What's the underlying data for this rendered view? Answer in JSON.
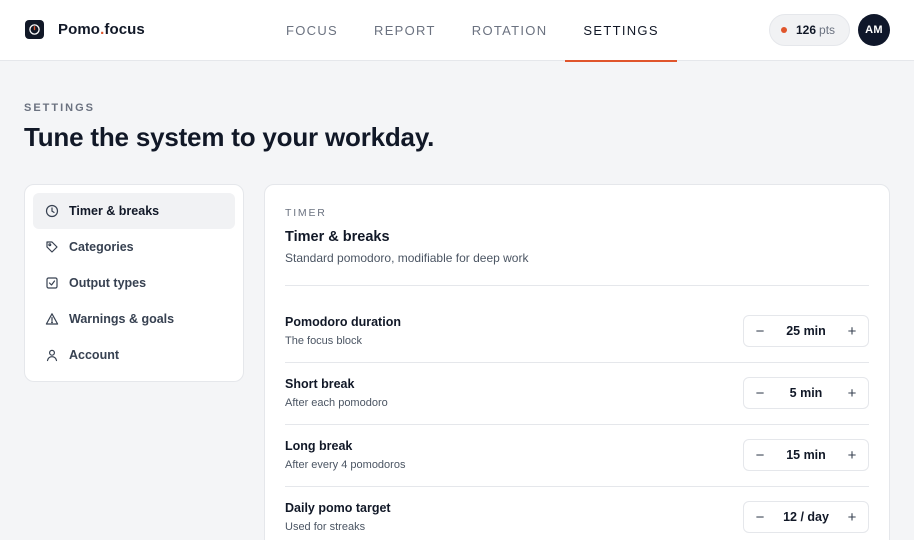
{
  "brand": {
    "name": "Pomo",
    "dot": ".",
    "suffix": "focus"
  },
  "nav": {
    "tabs": [
      {
        "label": "FOCUS"
      },
      {
        "label": "REPORT"
      },
      {
        "label": "ROTATION"
      },
      {
        "label": "SETTINGS",
        "active": true
      }
    ]
  },
  "points": {
    "value": "126",
    "unit": "pts"
  },
  "user": {
    "initials": "AM"
  },
  "page": {
    "eyebrow": "SETTINGS",
    "title": "Tune the system to your workday."
  },
  "sidebar": {
    "items": [
      {
        "label": "Timer & breaks",
        "icon": "clock-icon",
        "active": true
      },
      {
        "label": "Categories",
        "icon": "tag-icon"
      },
      {
        "label": "Output types",
        "icon": "checkbox-icon"
      },
      {
        "label": "Warnings & goals",
        "icon": "warning-icon"
      },
      {
        "label": "Account",
        "icon": "user-icon"
      }
    ]
  },
  "section": {
    "eyebrow": "TIMER",
    "title": "Timer & breaks",
    "subtitle": "Standard pomodoro, modifiable for deep work",
    "rows": [
      {
        "label": "Pomodoro duration",
        "hint": "The focus block",
        "value": "25 min"
      },
      {
        "label": "Short break",
        "hint": "After each pomodoro",
        "value": "5 min"
      },
      {
        "label": "Long break",
        "hint": "After every 4 pomodoros",
        "value": "15 min"
      },
      {
        "label": "Daily pomo target",
        "hint": "Used for streaks",
        "value": "12 / day"
      }
    ],
    "minus": "−",
    "plus": "+"
  },
  "colors": {
    "accent": "#e0552c",
    "dark": "#0f172a"
  }
}
